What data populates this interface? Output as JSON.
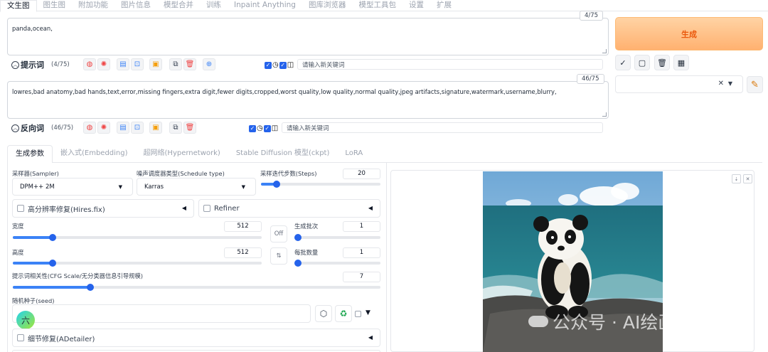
{
  "top_tabs": [
    "文生图",
    "图生图",
    "附加功能",
    "图片信息",
    "模型合并",
    "训练",
    "Inpaint Anything",
    "图库浏览器",
    "模型工具包",
    "设置",
    "扩展"
  ],
  "prompt": {
    "text": "panda,ocean,",
    "counter": "4/75",
    "label": "提示词",
    "count": "(4/75)",
    "keyword_placeholder": "请输入新关键词"
  },
  "negative": {
    "text": "lowres,bad anatomy,bad hands,text,error,missing fingers,extra digit,fewer digits,cropped,worst quality,low quality,normal quality,jpeg artifacts,signature,watermark,username,blurry,",
    "counter": "46/75",
    "label": "反向词",
    "count": "(46/75)",
    "keyword_placeholder": "请输入新关键词"
  },
  "generate_label": "生成",
  "sub_tabs": [
    "生成参数",
    "嵌入式(Embedding)",
    "超网络(Hypernetwork)",
    "Stable Diffusion 模型(ckpt)",
    "LoRA"
  ],
  "params": {
    "sampler_label": "采样器(Sampler)",
    "sampler_value": "DPM++ 2M",
    "schedule_label": "噪声调度器类型(Schedule type)",
    "schedule_value": "Karras",
    "steps_label": "采样迭代步数(Steps)",
    "steps_value": "20",
    "hires_label": "高分辨率修复(Hires.fix)",
    "refiner_label": "Refiner",
    "width_label": "宽度",
    "width_value": "512",
    "height_label": "高度",
    "height_value": "512",
    "off_label": "Off",
    "batch_count_label": "生成批次",
    "batch_count_value": "1",
    "batch_size_label": "每批数量",
    "batch_size_value": "1",
    "cfg_label": "提示词相关性(CFG Scale/无分类器信息引导规模)",
    "cfg_value": "7",
    "seed_label": "随机种子(seed)",
    "avatar_char": "六",
    "adetailer_label": "细节修复(ADetailer)"
  },
  "levels": {
    "steps": 0.13,
    "width": 0.16,
    "height": 0.16,
    "batch_count": 0.0,
    "batch_size": 0.0,
    "cfg": 0.21
  },
  "watermark": "公众号 · AI绘画先锋",
  "icons": {
    "prompt_tools": [
      "globe-icon",
      "gear-icon",
      "edit-doc-icon",
      "bookmark-icon",
      "photo-icon",
      "copy-icon",
      "trash-icon",
      "translate-icon"
    ],
    "action_buttons": [
      "check-icon",
      "square-icon",
      "trash-icon",
      "clipboard-icon"
    ]
  }
}
